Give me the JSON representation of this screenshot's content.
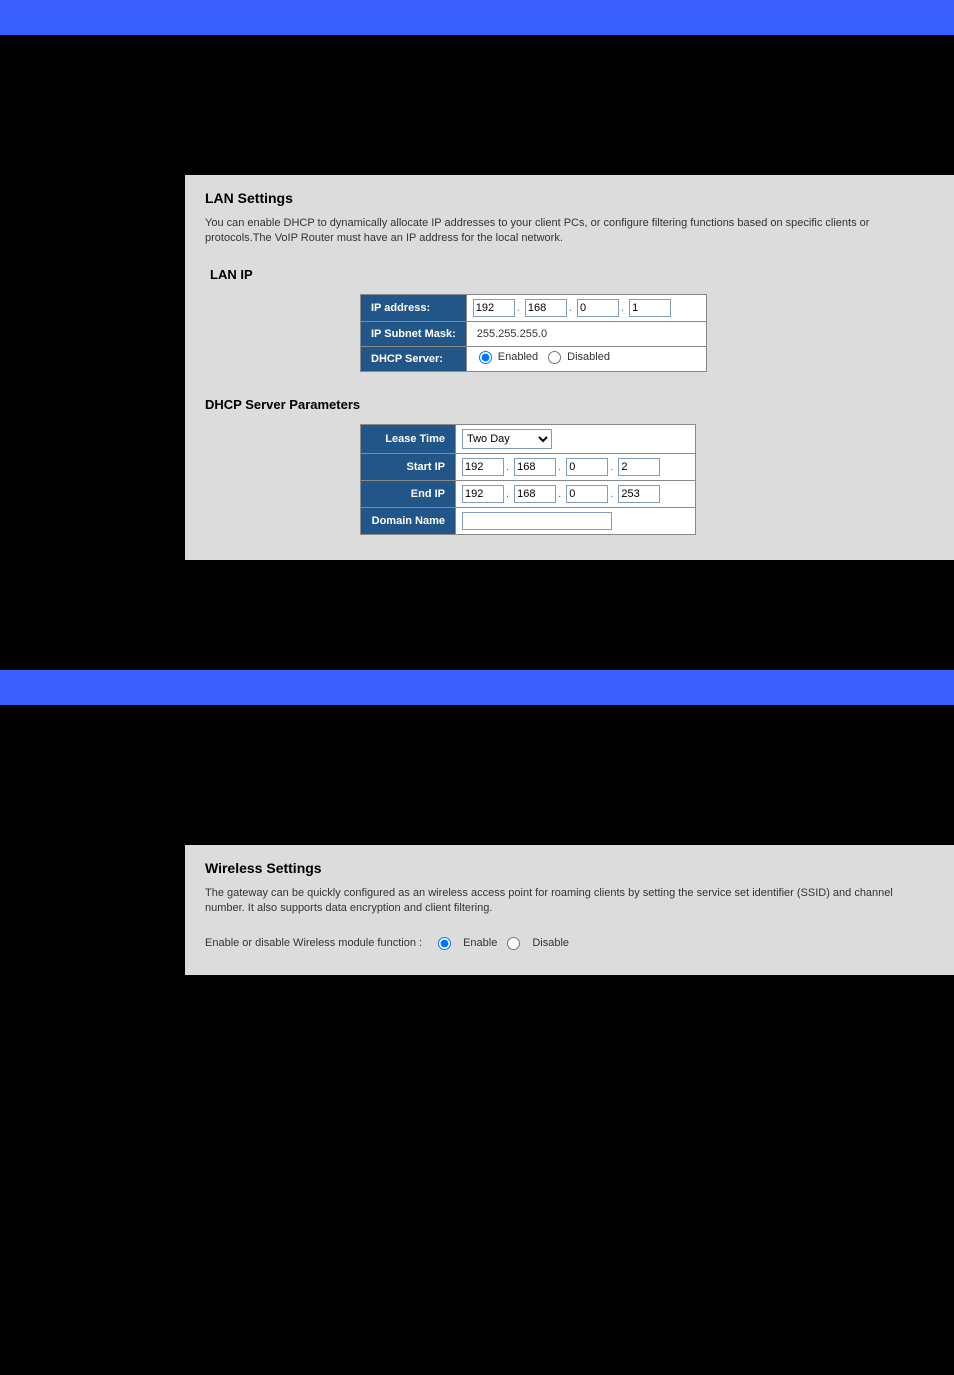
{
  "lan": {
    "title": "LAN Settings",
    "description": "You can enable DHCP to dynamically allocate IP addresses to your client PCs, or configure filtering functions based on specific clients or protocols.The VoIP Router must have an IP address for the local network.",
    "heading": "LAN IP",
    "rows": {
      "ip_label": "IP address:",
      "ip": {
        "a": "192",
        "b": "168",
        "c": "0",
        "d": "1"
      },
      "mask_label": "IP Subnet Mask:",
      "mask_value": "255.255.255.0",
      "dhcp_label": "DHCP Server:",
      "dhcp_enabled": "Enabled",
      "dhcp_disabled": "Disabled"
    }
  },
  "dhcp": {
    "heading": "DHCP Server Parameters",
    "rows": {
      "lease_label": "Lease Time",
      "lease_value": "Two Day",
      "start_label": "Start IP",
      "start": {
        "a": "192",
        "b": "168",
        "c": "0",
        "d": "2"
      },
      "end_label": "End IP",
      "end": {
        "a": "192",
        "b": "168",
        "c": "0",
        "d": "253"
      },
      "domain_label": "Domain Name",
      "domain_value": ""
    }
  },
  "wireless": {
    "title": "Wireless Settings",
    "description": "The gateway can be quickly configured as an wireless access point for roaming clients by setting the service set identifier (SSID) and channel number. It also supports data encryption and client filtering.",
    "toggle_text": "Enable or disable Wireless module function : ",
    "enable": "Enable",
    "disable": "Disable"
  }
}
